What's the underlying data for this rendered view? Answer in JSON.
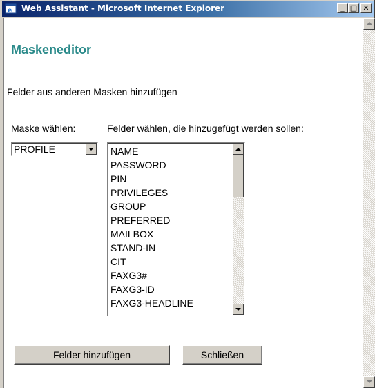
{
  "window": {
    "title": "Web Assistant - Microsoft Internet Explorer",
    "icon": "ie-icon",
    "controls": {
      "minimize": "_",
      "maximize": "□",
      "close": "✕"
    }
  },
  "page": {
    "title": "Maskeneditor",
    "section": "Felder aus anderen Masken hinzufügen",
    "mask_label": "Maske wählen:",
    "fields_label": "Felder wählen, die hinzugefügt werden sollen:"
  },
  "mask_select": {
    "selected": "PROFILE"
  },
  "fields_list": {
    "items": [
      "NAME",
      "PASSWORD",
      "PIN",
      "PRIVILEGES",
      "GROUP",
      "PREFERRED",
      "MAILBOX",
      "STAND-IN",
      "CIT",
      "FAXG3#",
      "FAXG3-ID",
      "FAXG3-HEADLINE"
    ]
  },
  "buttons": {
    "add": "Felder hinzufügen",
    "close": "Schließen"
  },
  "colors": {
    "title_accent": "#2a8a8a",
    "titlebar_start": "#0a246a",
    "titlebar_end": "#a6caf0",
    "chrome": "#d4d0c8"
  }
}
